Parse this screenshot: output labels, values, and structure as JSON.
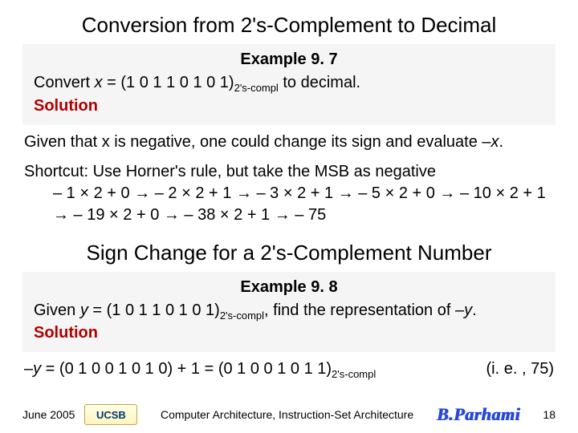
{
  "title": "Conversion from 2's-Complement to Decimal",
  "example1": {
    "label": "Example 9. 7",
    "prompt_pre": "Convert ",
    "var": "x",
    "eq": " = (1 0 1 1 0 1 0 1)",
    "sub": "2's-compl",
    "prompt_post": " to decimal.",
    "solution_label": "Solution"
  },
  "para1_pre": "Given that x is negative, one could change its sign and evaluate –",
  "para1_var": "x",
  "para1_post": ".",
  "shortcut_lead": "Shortcut: Use Horner's rule, but take the MSB as negative",
  "shortcut_line1": "– 1 × 2 + 0 → – 2 × 2 + 1 → – 3 × 2 + 1 → – 5 × 2 + 0 → – 10 × 2 + 1",
  "shortcut_line2": "→ – 19 × 2 + 0 → – 38 × 2 + 1 → – 75",
  "subtitle": "Sign Change for a 2's-Complement Number",
  "example2": {
    "label": "Example 9. 8",
    "given_pre": "Given ",
    "var": "y",
    "eq": " = (1 0 1 1 0 1 0 1)",
    "sub": "2's-compl",
    "given_post": ", find the representation of –",
    "var2": "y",
    "given_end": ".",
    "solution_label": "Solution"
  },
  "result_lead": "–",
  "result_var": "y",
  "result_mid": " = (0 1 0 0 1 0 1 0) + 1 = (0 1 0 0 1 0 1 1)",
  "result_sub": "2's-compl",
  "result_paren": "(i. e. , 75)",
  "footer": {
    "date": "June 2005",
    "logo": "UCSB",
    "chapter": "Computer Architecture, Instruction-Set Architecture",
    "author": "B.Parhami",
    "page": "18"
  }
}
